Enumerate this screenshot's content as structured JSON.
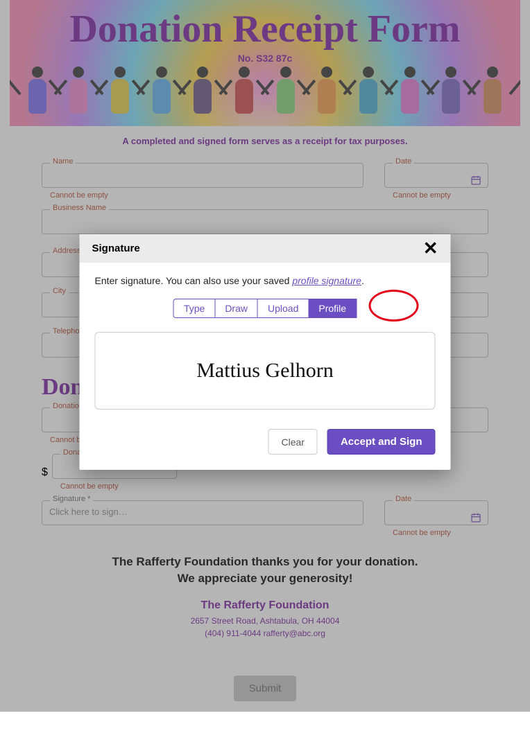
{
  "header": {
    "title": "Donation Receipt Form",
    "number": "No. S32 87c",
    "notice": "A completed and signed form serves as a receipt for tax purposes."
  },
  "fields": {
    "name_label": "Name",
    "name_error": "Cannot be empty",
    "date_label": "Date",
    "date_error": "Cannot be empty",
    "business_label": "Business Name",
    "address_label": "Address",
    "city_label": "City",
    "telephone_label": "Telephone"
  },
  "donation": {
    "section_title": "Donation",
    "desc_label": "Donation Description",
    "desc_error": "Cannot be empty",
    "value_label": "Donation Value",
    "value_error": "Cannot be empty",
    "currency_symbol": "$",
    "sig_label": "Signature *",
    "sig_placeholder": "Click here to sign…",
    "date_label": "Date",
    "date_error": "Cannot be empty"
  },
  "footer": {
    "thanks_line1": "The Rafferty Foundation thanks you for your donation.",
    "thanks_line2": "We appreciate your generosity!",
    "org": "The Rafferty Foundation",
    "address": "2657 Street Road, Ashtabula, OH 44004",
    "phone_email": "(404) 911-4044 rafferty@abc.org",
    "submit_label": "Submit"
  },
  "modal": {
    "title": "Signature",
    "desc_prefix": "Enter signature. You can also use your saved ",
    "desc_link": "profile signature",
    "desc_suffix": ".",
    "tabs": {
      "type": "Type",
      "draw": "Draw",
      "upload": "Upload",
      "profile": "Profile"
    },
    "active_tab": "profile",
    "signature_value": "Mattius Gelhorn",
    "clear_label": "Clear",
    "accept_label": "Accept and Sign"
  }
}
